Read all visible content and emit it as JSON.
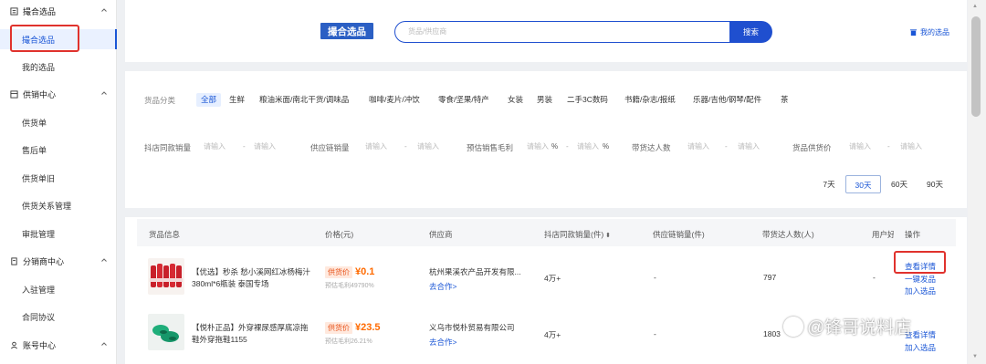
{
  "sidebar": {
    "groups": [
      {
        "label": "撮合选品",
        "icon": "square-list-icon"
      },
      {
        "label": "供销中心",
        "icon": "grid-icon"
      },
      {
        "label": "分销商中心",
        "icon": "doc-icon"
      },
      {
        "label": "账号中心",
        "icon": "user-icon"
      }
    ],
    "items": [
      {
        "label": "撮合选品"
      },
      {
        "label": "我的选品"
      },
      {
        "label": "供货单"
      },
      {
        "label": "售后单"
      },
      {
        "label": "供货单旧"
      },
      {
        "label": "供货关系管理"
      },
      {
        "label": "审批管理"
      },
      {
        "label": "入驻管理"
      },
      {
        "label": "合同协议"
      }
    ]
  },
  "header": {
    "logo_text": "撮合选品",
    "search_placeholder": "货品/供应商",
    "search_button": "搜索",
    "my_selection": "我的选品"
  },
  "filters": {
    "category_label": "货品分类",
    "categories": [
      "全部",
      "生鲜",
      "粮油米面/南北干货/调味品",
      "咖啡/麦片/冲饮",
      "零食/坚果/特产",
      "女装",
      "男装",
      "二手3C数码",
      "书籍/杂志/报纸",
      "乐器/吉他/钢琴/配件",
      "茶"
    ],
    "fields": [
      {
        "label": "抖店同款销量",
        "min": "请输入",
        "max": "请输入"
      },
      {
        "label": "供应链销量",
        "min": "请输入",
        "max": "请输入"
      },
      {
        "label": "预估销售毛利",
        "min": "请输入",
        "max": "请输入",
        "unit": "%"
      },
      {
        "label": "带货达人数",
        "min": "请输入",
        "max": "请输入"
      },
      {
        "label": "货品供货价",
        "min": "请输入",
        "max": "请输入"
      }
    ],
    "dash": "-",
    "ranges": [
      "7天",
      "30天",
      "60天",
      "90天"
    ],
    "selected_range": "30天"
  },
  "table": {
    "headers": {
      "product": "货品信息",
      "price": "价格(元)",
      "supplier": "供应商",
      "douyin_sales": "抖店同款销量(件)",
      "supply_sales": "供应链销量(件)",
      "creators": "带货达人数(人)",
      "user": "用户好",
      "ops": "操作"
    },
    "rows": [
      {
        "name": "【优选】秒杀 愁小溪网红冰杨梅汁380ml*6瓶装 泰国专场",
        "price_label": "供货价",
        "price": "¥0.1",
        "margin": "预估毛利49790%",
        "supplier": "杭州果溪农产品开发有限...",
        "cooperate": "去合作>",
        "douyin_sales": "4万+",
        "supply_sales": "-",
        "creators": "797",
        "user": "-",
        "ops": [
          "查看详情",
          "一键发品",
          "加入选品"
        ]
      },
      {
        "name": "【悦朴正品】外穿裸尿感厚底凉拖鞋外穿拖鞋1155",
        "price_label": "供货价",
        "price": "¥23.5",
        "margin": "预估毛利26.21%",
        "supplier": "义乌市悦朴贸易有限公司",
        "cooperate": "去合作>",
        "douyin_sales": "4万+",
        "supply_sales": "-",
        "creators": "1803",
        "user": "",
        "ops": [
          "查看详情",
          "加入选品"
        ]
      }
    ]
  },
  "watermark": "@锋哥说料店",
  "colors": {
    "accent": "#1f4fcf",
    "price": "#ff6a00",
    "highlight_box": "#e0322d"
  }
}
